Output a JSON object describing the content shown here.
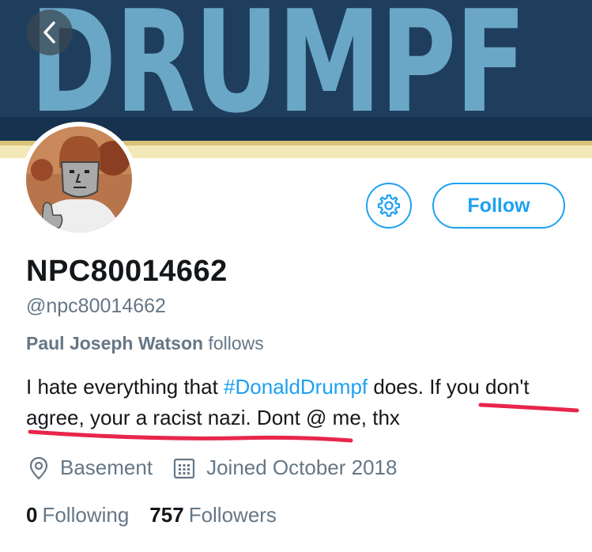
{
  "banner": {
    "text": "DRUMPF"
  },
  "profile": {
    "display_name": "NPC80014662",
    "handle": "@npc80014662",
    "followed_by_name": "Paul Joseph Watson",
    "followed_by_suffix": "follows"
  },
  "bio": {
    "text_before": "I hate everything that ",
    "hashtag": "#DonaldDrumpf",
    "text_after": " does. If you don't agree, your a racist nazi. Dont @ me, thx"
  },
  "meta": {
    "location": "Basement",
    "joined": "Joined October 2018"
  },
  "stats": {
    "following_count": "0",
    "following_label": "Following",
    "followers_count": "757",
    "followers_label": "Followers"
  },
  "actions": {
    "follow_label": "Follow"
  },
  "icons": [
    "back-icon",
    "gear-icon",
    "location-icon",
    "calendar-icon"
  ],
  "colors": {
    "accent": "#1da1f2",
    "secondary_text": "#657786",
    "annotation": "#e8264a"
  }
}
